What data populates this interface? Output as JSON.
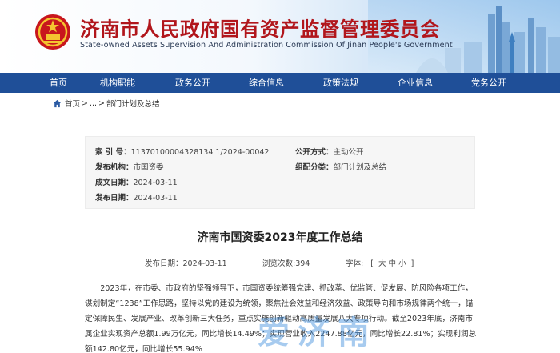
{
  "header": {
    "title": "济南市人民政府国有资产监督管理委员会",
    "subtitle": "State-owned Assets Supervision And Administration Commission Of Jinan People's Government"
  },
  "nav": {
    "items": [
      "首页",
      "机构职能",
      "政务公开",
      "综合信息",
      "政策法规",
      "企业信息",
      "党务公开"
    ]
  },
  "breadcrumb": {
    "home": "首页",
    "sep1": ">",
    "ellipsis": "...",
    "sep2": ">",
    "current": "部门计划及总结"
  },
  "meta": {
    "index_label": "索 引 号：",
    "index_value": "11370100004328134 1/2024-00042",
    "open_mode_label": "公开方式：",
    "open_mode_value": "主动公开",
    "org_label": "发布机构：",
    "org_value": "市国资委",
    "category_label": "组配分类：",
    "category_value": "部门计划及总结",
    "created_label": "成文日期：",
    "created_value": "2024-03-11",
    "published_label": "发布日期：",
    "published_value": "2024-03-11"
  },
  "article": {
    "title": "济南市国资委2023年度工作总结",
    "date_label": "发布日期：",
    "date_value": "2024-03-11",
    "views_label": "浏览次数:",
    "views_value": "394",
    "font_label": "字体:",
    "font_open": "[",
    "font_large": "大",
    "font_medium": "中",
    "font_small": "小",
    "font_close": "]",
    "body": "2023年，在市委、市政府的坚强领导下，市国资委统筹强党建、抓改革、优监管、促发展、防风险各项工作，谋划制定“1238”工作思路，坚持以党的建设为统领，聚焦社会效益和经济效益、政策导向和市场规律两个统一，锚定保障民生、发展产业、改革创新三大任务，重点实施创新驱动高质量发展八大专项行动。截至2023年底，济南市属企业实现资产总额1.99万亿元，同比增长14.49%；实现营业收入2247.88亿元，同比增长22.81%；实现利润总额142.80亿元，同比增长55.94%"
  },
  "watermark": "爱济南",
  "colors": {
    "title_red": "#b1161c",
    "nav_blue": "#1f4f98"
  }
}
